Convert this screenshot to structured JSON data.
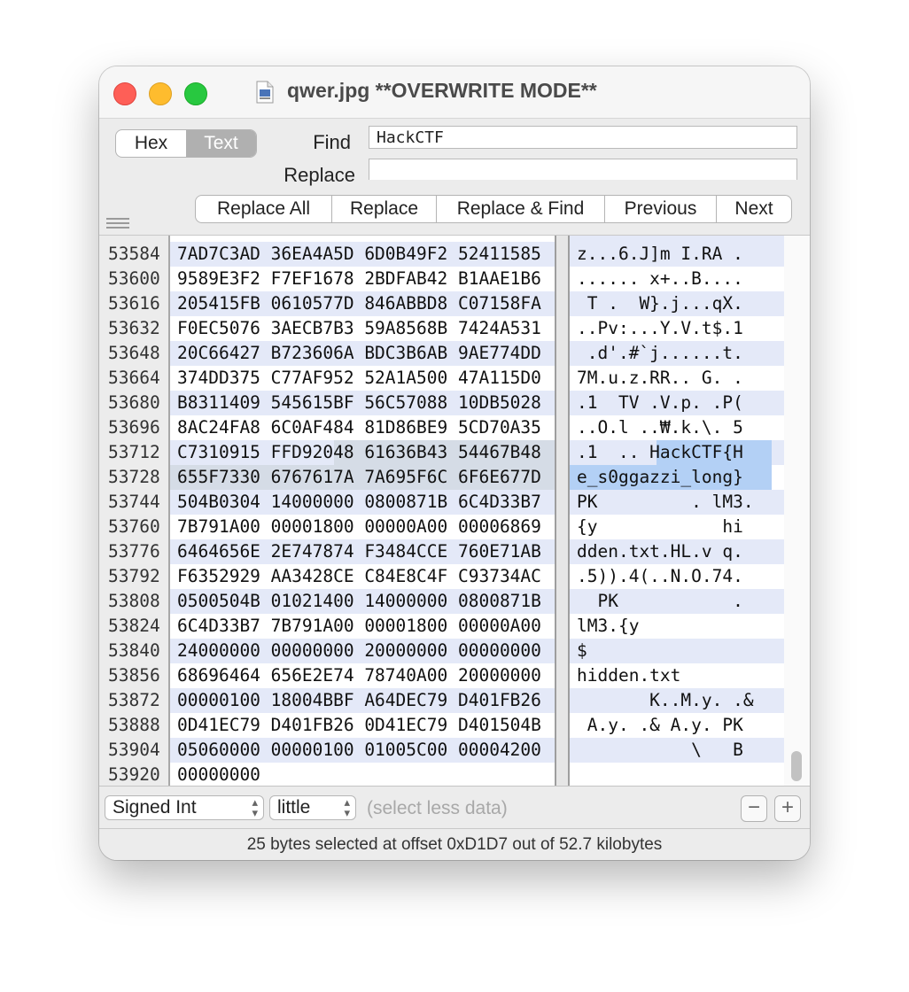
{
  "window": {
    "title": "qwer.jpg **OVERWRITE MODE**"
  },
  "toolbar": {
    "mode_hex": "Hex",
    "mode_text": "Text",
    "find_label": "Find",
    "find_value": "HackCTF",
    "replace_label": "Replace",
    "replace_value": "",
    "buttons": {
      "replace_all": "Replace All",
      "replace": "Replace",
      "replace_find": "Replace & Find",
      "previous": "Previous",
      "next": "Next"
    }
  },
  "hexview": {
    "rows": [
      {
        "offset": "53584",
        "hex": "7AD7C3AD 36EA4A5D 6D0B49F2 52411585",
        "text": "z...6.J]m I.RA ."
      },
      {
        "offset": "53600",
        "hex": "9589E3F2 F7EF1678 2BDFAB42 B1AAE1B6",
        "text": "...... x+..B...."
      },
      {
        "offset": "53616",
        "hex": "205415FB 0610577D 846ABBD8 C07158FA",
        "text": " T .  W}.j...qX."
      },
      {
        "offset": "53632",
        "hex": "F0EC5076 3AECB7B3 59A8568B 7424A531",
        "text": "..Pv:...Y.V.t$.1"
      },
      {
        "offset": "53648",
        "hex": "20C66427 B723606A BDC3B6AB 9AE774DD",
        "text": " .d'.#`j......t."
      },
      {
        "offset": "53664",
        "hex": "374DD375 C77AF952 52A1A500 47A115D0",
        "text": "7M.u.z.RR.. G. ."
      },
      {
        "offset": "53680",
        "hex": "B8311409 545615BF 56C57088 10DB5028",
        "text": ".1  TV .V.p. .P("
      },
      {
        "offset": "53696",
        "hex": "8AC24FA8 6C0AF484 81D86BE9 5CD70A35",
        "text": "..O.l ..₩.k.\\. 5"
      },
      {
        "offset": "53712",
        "hex": "C7310915 FFD92048 61636B43 54467B48",
        "text": ".1  .. HackCTF{H"
      },
      {
        "offset": "53728",
        "hex": "655F7330 6767617A 7A695F6C 6F6E677D",
        "text": "e_s0ggazzi_long}"
      },
      {
        "offset": "53744",
        "hex": "504B0304 14000000 0800871B 6C4D33B7",
        "text": "PK         . lM3."
      },
      {
        "offset": "53760",
        "hex": "7B791A00 00001800 00000A00 00006869",
        "text": "{y            hi"
      },
      {
        "offset": "53776",
        "hex": "6464656E 2E747874 F3484CCE 760E71AB",
        "text": "dden.txt.HL.v q."
      },
      {
        "offset": "53792",
        "hex": "F6352929 AA3428CE C84E8C4F C93734AC",
        "text": ".5)).4(..N.O.74."
      },
      {
        "offset": "53808",
        "hex": "0500504B 01021400 14000000 0800871B",
        "text": "  PK           ."
      },
      {
        "offset": "53824",
        "hex": "6C4D33B7 7B791A00 00001800 00000A00",
        "text": "lM3.{y"
      },
      {
        "offset": "53840",
        "hex": "24000000 00000000 20000000 00000000",
        "text": "$"
      },
      {
        "offset": "53856",
        "hex": "68696464 656E2E74 78740A00 20000000",
        "text": "hidden.txt"
      },
      {
        "offset": "53872",
        "hex": "00000100 18004BBF A64DEC79 D401FB26",
        "text": "       K..M.y. .&"
      },
      {
        "offset": "53888",
        "hex": "0D41EC79 D401FB26 0D41EC79 D401504B",
        "text": " A.y. .& A.y. PK"
      },
      {
        "offset": "53904",
        "hex": "05060000 00000100 01005C00 00004200",
        "text": "           \\   B"
      },
      {
        "offset": "53920",
        "hex": "00000000",
        "text": ""
      }
    ]
  },
  "bottom": {
    "type_select": "Signed Int",
    "endian_select": "little",
    "hint": "(select less data)",
    "minus": "−",
    "plus": "+"
  },
  "status": "25 bytes selected at offset 0xD1D7 out of 52.7 kilobytes",
  "colors": {
    "band": "#e4e9f8",
    "selection_hex": "#d5dce6",
    "selection_text": "#b3d0f5"
  }
}
